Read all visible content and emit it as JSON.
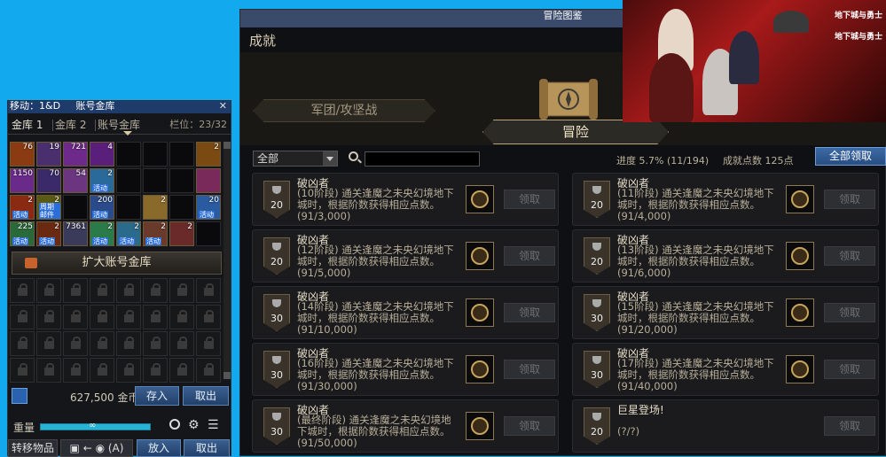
{
  "storage": {
    "title_fragment": "移动：1&D",
    "title": "账号金库",
    "tabs": [
      "金库 1",
      "金库 2",
      "账号金库"
    ],
    "capacity": "栏位：23/32",
    "items": [
      {
        "count": "76"
      },
      {
        "count": "19"
      },
      {
        "count": "721"
      },
      {
        "count": "4"
      },
      {
        "count": ""
      },
      {
        "count": ""
      },
      {
        "count": ""
      },
      {
        "count": "2"
      },
      {
        "count": "1150"
      },
      {
        "count": "70"
      },
      {
        "count": "54"
      },
      {
        "count": "2",
        "tag": "活动"
      },
      {
        "count": ""
      },
      {
        "count": ""
      },
      {
        "count": ""
      },
      {
        "count": ""
      },
      {
        "count": "2",
        "tag": "活动"
      },
      {
        "count": "2",
        "tag": "周期邮件"
      },
      {
        "count": ""
      },
      {
        "count": "200",
        "tag": "活动"
      },
      {
        "count": ""
      },
      {
        "count": "2"
      },
      {
        "count": ""
      },
      {
        "count": "20",
        "tag": "活动"
      },
      {
        "count": "225",
        "tag": "活动"
      },
      {
        "count": "2",
        "tag": "活动"
      },
      {
        "count": "7361"
      },
      {
        "count": "2",
        "tag": "活动"
      },
      {
        "count": "2",
        "tag": "活动"
      },
      {
        "count": "2",
        "tag": "活动"
      },
      {
        "count": "2"
      },
      {
        "count": ""
      }
    ],
    "expand_label": "扩大账号金库",
    "gold": "627,500 金币",
    "deposit_label": "存入",
    "withdraw_label": "取出",
    "weight_label": "重量",
    "weight_value": "∞",
    "weight_fraction": 1.0,
    "transfer_label": "转移物品",
    "shortcut_label": "(A)",
    "put_label": "放入",
    "take_label": "取出"
  },
  "achievement": {
    "window_title": "冒险图鉴",
    "heading": "成就",
    "tab_guild": "军团/攻坚战",
    "tab_adventure": "冒险",
    "filter_value": "全部",
    "progress": "进度  5.7% (11/194)",
    "points": "成就点数 125点",
    "claim_all": "全部领取",
    "cards": [
      {
        "points": "20",
        "name": "破凶者",
        "desc": "(10阶段) 通关逢魔之未央幻境地下城时，根据阶数获得相应点数。",
        "progress": "(91/3,000)",
        "claim": "领取"
      },
      {
        "points": "20",
        "name": "破凶者",
        "desc": "(11阶段) 通关逢魔之未央幻境地下城时，根据阶数获得相应点数。",
        "progress": "(91/4,000)",
        "claim": "领取"
      },
      {
        "points": "20",
        "name": "破凶者",
        "desc": "(12阶段) 通关逢魔之未央幻境地下城时，根据阶数获得相应点数。",
        "progress": "(91/5,000)",
        "claim": "领取"
      },
      {
        "points": "20",
        "name": "破凶者",
        "desc": "(13阶段) 通关逢魔之未央幻境地下城时，根据阶数获得相应点数。",
        "progress": "(91/6,000)",
        "claim": "领取"
      },
      {
        "points": "30",
        "name": "破凶者",
        "desc": "(14阶段) 通关逢魔之未央幻境地下城时，根据阶数获得相应点数。",
        "progress": "(91/10,000)",
        "claim": "领取"
      },
      {
        "points": "30",
        "name": "破凶者",
        "desc": "(15阶段) 通关逢魔之未央幻境地下城时，根据阶数获得相应点数。",
        "progress": "(91/20,000)",
        "claim": "领取"
      },
      {
        "points": "30",
        "name": "破凶者",
        "desc": "(16阶段) 通关逢魔之未央幻境地下城时，根据阶数获得相应点数。",
        "progress": "(91/30,000)",
        "claim": "领取"
      },
      {
        "points": "30",
        "name": "破凶者",
        "desc": "(17阶段) 通关逢魔之未央幻境地下城时，根据阶数获得相应点数。",
        "progress": "(91/40,000)",
        "claim": "领取"
      },
      {
        "points": "30",
        "name": "破凶者",
        "desc": "(最终阶段) 通关逢魔之未央幻境地下城时，根据阶数获得相应点数。",
        "progress": "(91/50,000)",
        "claim": "领取"
      },
      {
        "points": "20",
        "name": "巨星登场!",
        "desc": "",
        "progress": "(?/?)",
        "claim": "领取"
      }
    ]
  },
  "ad": {
    "logos": [
      "地下城与勇士",
      "地下城与勇士"
    ]
  },
  "colors": {
    "desktop": "#12a9ee",
    "accent_blue": "#3d6aa6",
    "gold_frame": "#c7a45c"
  }
}
